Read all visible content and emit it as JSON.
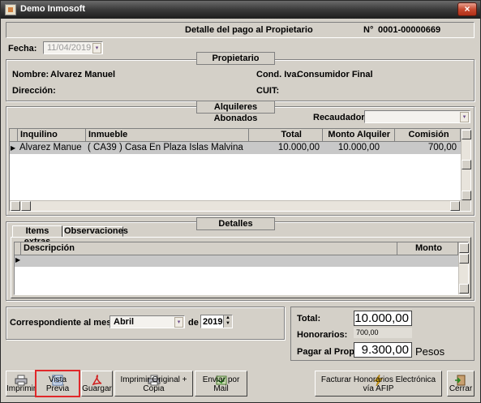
{
  "window": {
    "title": "Demo Inmosoft",
    "close_symbol": "×"
  },
  "header": {
    "title": "Detalle del pago al Propietario",
    "number_label": "N°",
    "number_value": "0001-00000669"
  },
  "fecha": {
    "label": "Fecha:",
    "value": "11/04/2019"
  },
  "propietario": {
    "legend": "Propietario",
    "nombre_label": "Nombre:",
    "nombre_value": "Alvarez Manuel",
    "iva_label": "Cond. Iva:",
    "iva_value": "Consumidor Final",
    "direccion_label": "Dirección:",
    "cuit_label": "CUIT:"
  },
  "alquileres": {
    "legend": "Alquileres Abonados",
    "recaudadora_label": "Recaudadora:",
    "columns": [
      "Inquilino",
      "Inmueble",
      "Total",
      "Monto Alquiler",
      "Comisión"
    ],
    "row": {
      "indicator": "▶",
      "inquilino": "Alvarez Manue",
      "inmueble": "( CA39  ) Casa En Plaza Islas Malvina",
      "total": "10.000,00",
      "monto": "10.000,00",
      "comision": "700,00"
    }
  },
  "detalles": {
    "legend": "Detalles",
    "tabs": [
      "Items extras",
      "Observaciones"
    ],
    "columns": [
      "Descripción",
      "Monto"
    ],
    "row_indicator": "▶"
  },
  "mes": {
    "label": "Correspondiente al mes de:",
    "value": "Abril",
    "de_label": "de",
    "year": "2019"
  },
  "totales": {
    "total_label": "Total:",
    "total_value": "10.000,00",
    "honorarios_label": "Honorarios:",
    "honorarios_value": "700,00",
    "pagar_label": "Pagar al Prop:",
    "pagar_value": "9.300,00",
    "currency": "Pesos"
  },
  "toolbar": {
    "imprimir": "Imprimir",
    "vista_previa": "Vista Previa",
    "guardar": "Guargar",
    "imprimir_original": "Imprimir Original + Copia",
    "enviar_mail": "Enviar por Mail",
    "facturar": "Facturar Honorarios Electrónica vía AFIP",
    "cerrar": "Cerrar"
  },
  "colors": {
    "highlight_border": "#e0282a",
    "selected_row": "#c8c8c8",
    "grid_bg": "#ffffff"
  }
}
